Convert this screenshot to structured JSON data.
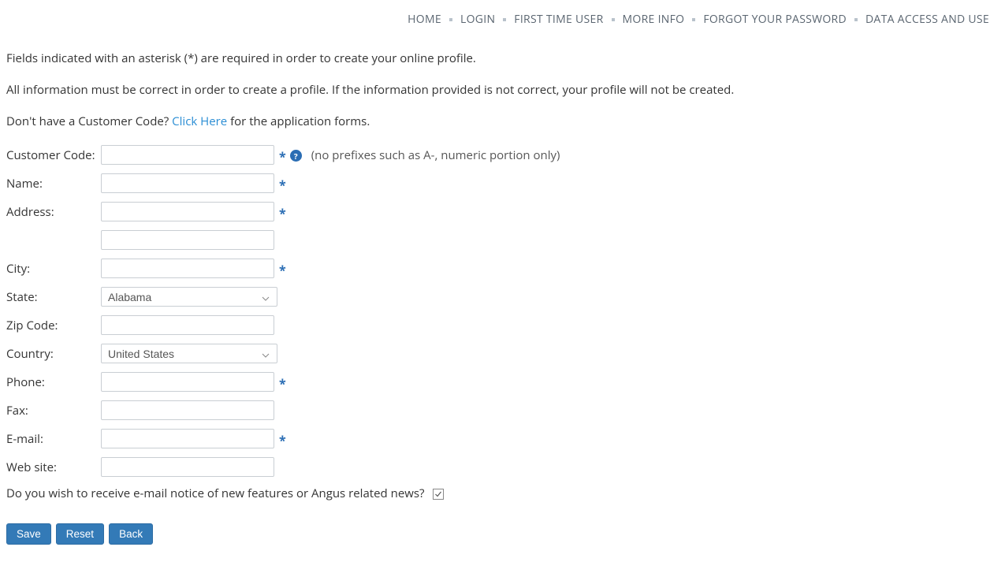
{
  "nav": {
    "items": [
      {
        "label": "HOME"
      },
      {
        "label": "LOGIN"
      },
      {
        "label": "FIRST TIME USER"
      },
      {
        "label": "MORE INFO"
      },
      {
        "label": "FORGOT YOUR PASSWORD"
      },
      {
        "label": "DATA ACCESS AND USE"
      }
    ]
  },
  "intro": {
    "p1": "Fields indicated with an asterisk (*) are required in order to create your online profile.",
    "p2": "All information must be correct in order to create a profile. If the information provided is not correct, your profile will not be created.",
    "p3_pre": "Don't have a Customer Code? ",
    "p3_link": "Click Here",
    "p3_post": " for the application forms."
  },
  "form": {
    "customer_code": {
      "label": "Customer Code:",
      "value": "",
      "hint": "(no prefixes such as A-, numeric portion only)"
    },
    "name": {
      "label": "Name:",
      "value": ""
    },
    "address": {
      "label": "Address:",
      "value": ""
    },
    "address2": {
      "value": ""
    },
    "city": {
      "label": "City:",
      "value": ""
    },
    "state": {
      "label": "State:",
      "selected": "Alabama"
    },
    "zip": {
      "label": "Zip Code:",
      "value": ""
    },
    "country": {
      "label": "Country:",
      "selected": "United States"
    },
    "phone": {
      "label": "Phone:",
      "value": ""
    },
    "fax": {
      "label": "Fax:",
      "value": ""
    },
    "email": {
      "label": "E-mail:",
      "value": ""
    },
    "website": {
      "label": "Web site:",
      "value": ""
    },
    "subscribe": {
      "label": "Do you wish to receive e-mail notice of new features or Angus related news?",
      "checked": true
    }
  },
  "buttons": {
    "save": "Save",
    "reset": "Reset",
    "back": "Back"
  },
  "symbols": {
    "asterisk": "*",
    "help": "?"
  }
}
